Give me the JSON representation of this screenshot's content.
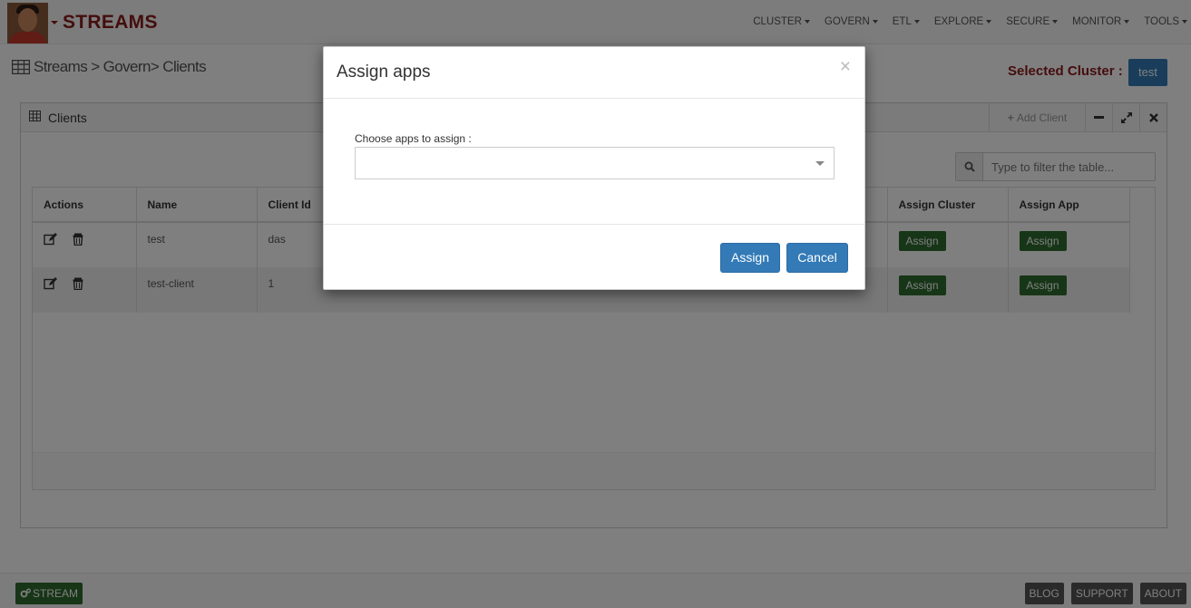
{
  "navbar": {
    "brand": "STREAMS",
    "menu": [
      {
        "label": "CLUSTER"
      },
      {
        "label": "GOVERN"
      },
      {
        "label": "ETL"
      },
      {
        "label": "EXPLORE"
      },
      {
        "label": "SECURE"
      },
      {
        "label": "MONITOR"
      },
      {
        "label": "TOOLS"
      }
    ]
  },
  "breadcrumb": {
    "text": "Streams > Govern> Clients"
  },
  "cluster": {
    "label": "Selected Cluster :",
    "value": "test"
  },
  "panel": {
    "title": "Clients",
    "add_label": "Add Client",
    "tools": [
      "minimize-icon",
      "expand-icon",
      "close-icon"
    ]
  },
  "filter": {
    "placeholder": "Type to filter the table..."
  },
  "table": {
    "columns": [
      "Actions",
      "Name",
      "Client Id",
      "Assign Cluster",
      "Assign App"
    ],
    "rows": [
      {
        "name": "test",
        "client_id": "das",
        "assign_cluster": "Assign",
        "assign_app": "Assign"
      },
      {
        "name": "test-client",
        "client_id": "1",
        "assign_cluster": "Assign",
        "assign_app": "Assign"
      }
    ]
  },
  "footer": {
    "stream_label": "STREAM",
    "links": [
      "BLOG",
      "SUPPORT",
      "ABOUT"
    ]
  },
  "modal": {
    "title": "Assign apps",
    "close_symbol": "×",
    "choose_label": "Choose apps to assign :",
    "assign_label": "Assign",
    "cancel_label": "Cancel"
  },
  "colors": {
    "brand": "#8b1a1a",
    "primary": "#337ab7",
    "success": "#2e6b2e"
  }
}
